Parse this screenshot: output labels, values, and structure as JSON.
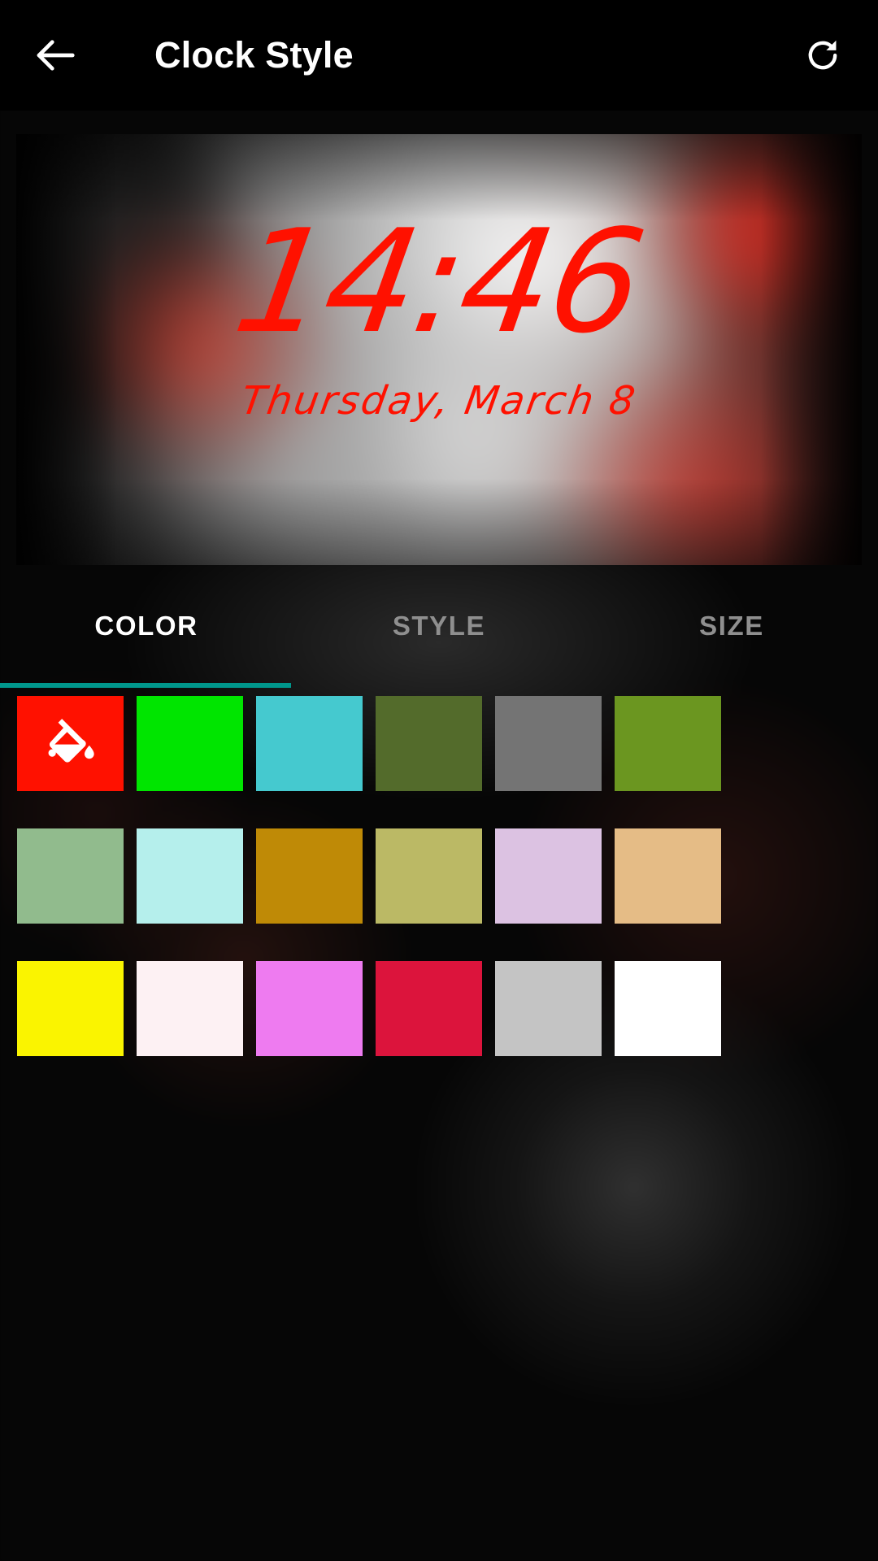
{
  "appbar": {
    "back_icon": "arrow-left-icon",
    "title": "Clock Style",
    "refresh_icon": "refresh-icon"
  },
  "preview": {
    "time": "14:46",
    "date": "Thursday, March 8",
    "clock_color": "#FF1100",
    "description": "blurred wallpaper preview with handwriting-style red clock"
  },
  "tabs": {
    "items": [
      {
        "label": "COLOR",
        "active": true
      },
      {
        "label": "STYLE",
        "active": false
      },
      {
        "label": "SIZE",
        "active": false
      }
    ],
    "indicator_color": "#00978c",
    "active_text_color": "#ffffff",
    "inactive_text_color": "#8f8f8f"
  },
  "colors": {
    "selected_index": 0,
    "selected_icon": "paint-bucket-icon",
    "swatches": [
      {
        "name": "red",
        "hex": "#FF1100"
      },
      {
        "name": "green",
        "hex": "#00E500"
      },
      {
        "name": "turquoise",
        "hex": "#45C9CF"
      },
      {
        "name": "dark-olive",
        "hex": "#536B2B"
      },
      {
        "name": "gray",
        "hex": "#747474"
      },
      {
        "name": "olive-drab",
        "hex": "#6B9620"
      },
      {
        "name": "dark-sea-green",
        "hex": "#91BB8D"
      },
      {
        "name": "pale-turquoise",
        "hex": "#B5EFEC"
      },
      {
        "name": "dark-goldenrod",
        "hex": "#BF8A06"
      },
      {
        "name": "dark-khaki",
        "hex": "#BBB965"
      },
      {
        "name": "thistle",
        "hex": "#DCC2E2"
      },
      {
        "name": "burlywood",
        "hex": "#E5BC86"
      },
      {
        "name": "yellow",
        "hex": "#FAF400"
      },
      {
        "name": "lavender-blush",
        "hex": "#FDF1F3"
      },
      {
        "name": "violet",
        "hex": "#EE7BF0"
      },
      {
        "name": "crimson",
        "hex": "#DC143C"
      },
      {
        "name": "silver",
        "hex": "#C4C4C4"
      },
      {
        "name": "white",
        "hex": "#FFFFFF"
      }
    ]
  }
}
